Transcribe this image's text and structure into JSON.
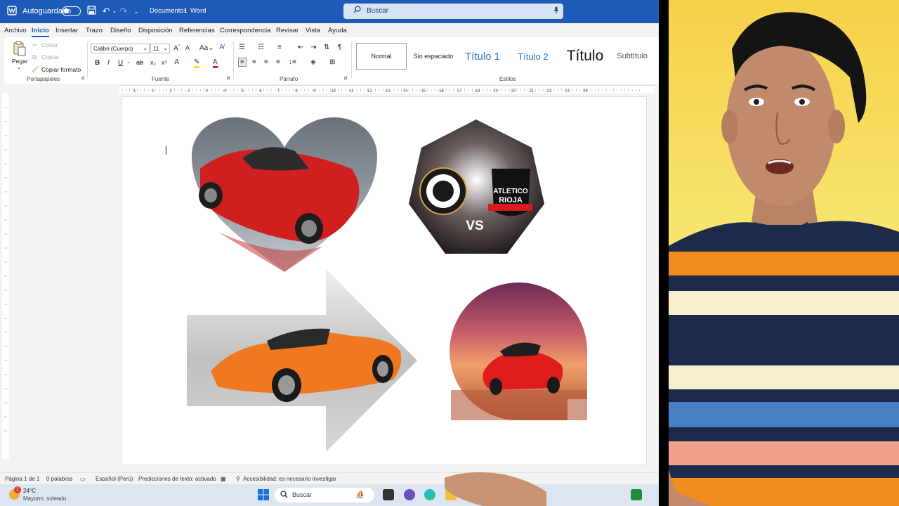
{
  "titlebar": {
    "autosave_label": "Autoguardado",
    "doc_title": "Documento1",
    "separator": "•",
    "app_name": "Word",
    "search_placeholder": "Buscar"
  },
  "menu": [
    "Archivo",
    "Inicio",
    "Insertar",
    "Trazo",
    "Diseño",
    "Disposición",
    "Referencias",
    "Correspondencia",
    "Revisar",
    "Vista",
    "Ayuda"
  ],
  "menu_active": "Inicio",
  "ribbon": {
    "clipboard": {
      "paste": "Pegar",
      "cut": "Cortar",
      "copy": "Copiar",
      "format_painter": "Copiar formato",
      "group": "Portapapeles"
    },
    "font": {
      "name": "Calibri (Cuerpo)",
      "size": "11",
      "group": "Fuente",
      "bold": "B",
      "italic": "I",
      "underline": "U"
    },
    "paragraph": {
      "group": "Párrafo"
    },
    "styles": {
      "group": "Estilos",
      "items": [
        "Normal",
        "Sin espaciado",
        "Título 1",
        "Título 2",
        "Título",
        "Subtítulo"
      ]
    }
  },
  "ruler_numbers": [
    "1",
    "2",
    "1",
    "2",
    "3",
    "4",
    "5",
    "6",
    "7",
    "8",
    "9",
    "10",
    "11",
    "12",
    "13",
    "14",
    "15",
    "16",
    "17",
    "18",
    "19",
    "20",
    "21",
    "22",
    "23",
    "24"
  ],
  "document": {
    "images": [
      {
        "shape": "heart",
        "subject": "red-convertible"
      },
      {
        "shape": "heptagon",
        "subject": "match-badge",
        "vs_text": "VS",
        "right_badge_text": "ATLETICO",
        "right_badge_sub": "RIOJA",
        "left_badge_text": "FRANCO CANADIENSE FC",
        "left_badge_sub": "MOYOBAMBA"
      },
      {
        "shape": "arrow",
        "subject": "orange-convertible"
      },
      {
        "shape": "rounded-teardrop",
        "subject": "red-roadster"
      }
    ]
  },
  "status": {
    "page": "Página 1 de 1",
    "words": "0 palabras",
    "language": "Español (Perú)",
    "predictions": "Predicciones de texto: activado",
    "accessibility": "Accesibilidad: es necesario investigar"
  },
  "taskbar": {
    "weather_temp": "24°C",
    "weather_desc": "Mayorm. soleado",
    "badge": "1",
    "search": "Buscar"
  },
  "colors": {
    "accent": "#1e5bb8",
    "presenter_bg": "#f5d04a"
  }
}
